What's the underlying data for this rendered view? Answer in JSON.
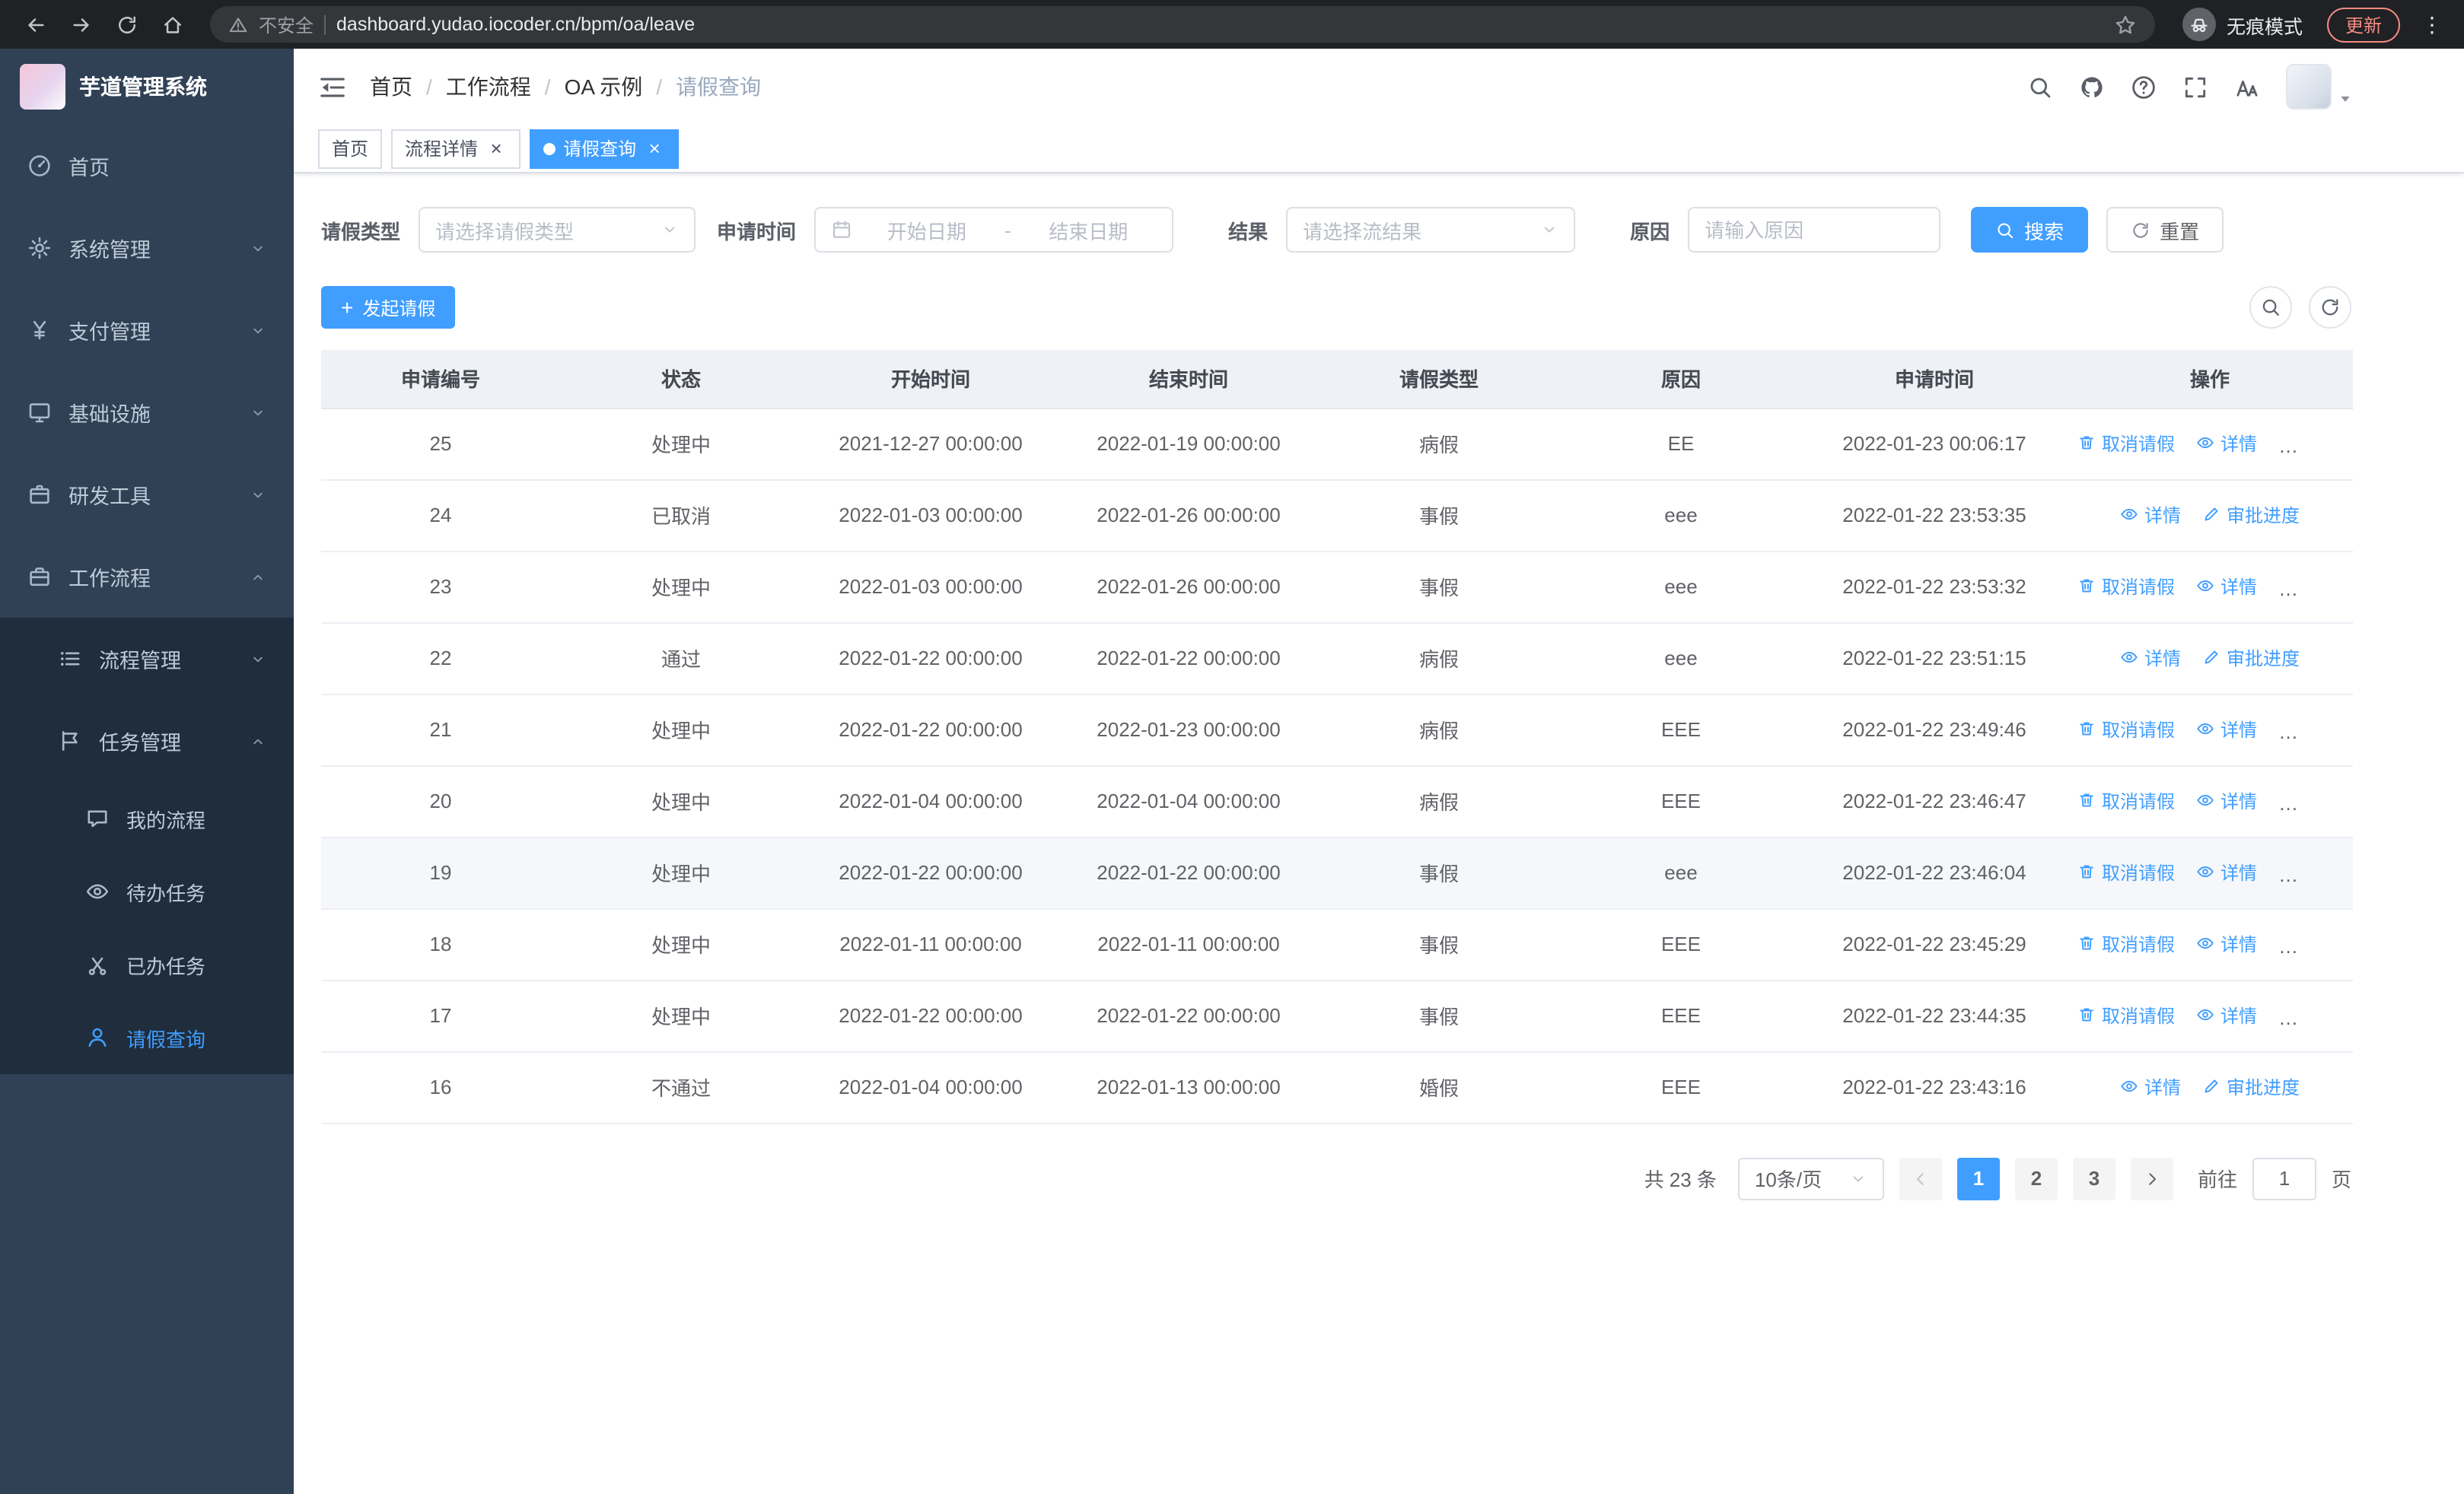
{
  "theme": {
    "accent": "#409eff",
    "sidebar_bg": "#304156",
    "submenu_bg": "#1f2d3d",
    "sidebar_text": "#bfcbd9",
    "table_header_bg": "#eef1f6"
  },
  "browser": {
    "security_warning": "不安全",
    "url": "dashboard.yudao.iocoder.cn/bpm/oa/leave",
    "incognito_label": "无痕模式",
    "update_button": "更新"
  },
  "sidebar": {
    "logo_title": "芋道管理系统",
    "items": [
      {
        "key": "home",
        "label": "首页",
        "icon": "dashboard",
        "expandable": false
      },
      {
        "key": "system-management",
        "label": "系统管理",
        "icon": "gear",
        "expandable": true
      },
      {
        "key": "payment-management",
        "label": "支付管理",
        "icon": "yen",
        "expandable": true
      },
      {
        "key": "infrastructure",
        "label": "基础设施",
        "icon": "infra",
        "expandable": true
      },
      {
        "key": "dev-tools",
        "label": "研发工具",
        "icon": "devtools",
        "expandable": true
      },
      {
        "key": "workflow",
        "label": "工作流程",
        "icon": "workflow",
        "expandable": true,
        "expanded": true
      }
    ],
    "submenu": [
      {
        "key": "process-management",
        "label": "流程管理",
        "icon": "list",
        "expandable": true,
        "expanded": false
      },
      {
        "key": "task-management",
        "label": "任务管理",
        "icon": "flag",
        "expandable": true,
        "expanded": true,
        "children": [
          {
            "key": "my-process",
            "label": "我的流程",
            "icon": "chat",
            "active": false
          },
          {
            "key": "todo-task",
            "label": "待办任务",
            "icon": "eye",
            "active": false
          },
          {
            "key": "done-task",
            "label": "已办任务",
            "icon": "scissors",
            "active": false
          },
          {
            "key": "leave-query",
            "label": "请假查询",
            "icon": "user",
            "active": true
          }
        ]
      }
    ]
  },
  "header": {
    "breadcrumb": [
      "首页",
      "工作流程",
      "OA 示例",
      "请假查询"
    ]
  },
  "tabs": [
    {
      "key": "home",
      "label": "首页",
      "closable": false,
      "active": false
    },
    {
      "key": "process-detail",
      "label": "流程详情",
      "closable": true,
      "active": false
    },
    {
      "key": "leave-query",
      "label": "请假查询",
      "closable": true,
      "active": true
    }
  ],
  "filters": {
    "leave_type_label": "请假类型",
    "leave_type_placeholder": "请选择请假类型",
    "apply_time_label": "申请时间",
    "start_date_placeholder": "开始日期",
    "date_separator": "-",
    "end_date_placeholder": "结束日期",
    "result_label": "结果",
    "result_placeholder": "请选择流结果",
    "reason_label": "原因",
    "reason_placeholder": "请输入原因",
    "search_button": "搜索",
    "reset_button": "重置"
  },
  "toolbar": {
    "create_button": "发起请假",
    "plus": "+"
  },
  "table": {
    "columns": [
      "申请编号",
      "状态",
      "开始时间",
      "结束时间",
      "请假类型",
      "原因",
      "申请时间",
      "操作"
    ],
    "actions": {
      "cancel": "取消请假",
      "detail": "详情",
      "progress": "审批进度"
    },
    "rows": [
      {
        "id": "25",
        "status": "处理中",
        "start": "2021-12-27 00:00:00",
        "end": "2022-01-19 00:00:00",
        "type": "病假",
        "reason": "EE",
        "apply_time": "2022-01-23 00:06:17",
        "can_cancel": true,
        "hover": false
      },
      {
        "id": "24",
        "status": "已取消",
        "start": "2022-01-03 00:00:00",
        "end": "2022-01-26 00:00:00",
        "type": "事假",
        "reason": "eee",
        "apply_time": "2022-01-22 23:53:35",
        "can_cancel": false,
        "hover": false
      },
      {
        "id": "23",
        "status": "处理中",
        "start": "2022-01-03 00:00:00",
        "end": "2022-01-26 00:00:00",
        "type": "事假",
        "reason": "eee",
        "apply_time": "2022-01-22 23:53:32",
        "can_cancel": true,
        "hover": false
      },
      {
        "id": "22",
        "status": "通过",
        "start": "2022-01-22 00:00:00",
        "end": "2022-01-22 00:00:00",
        "type": "病假",
        "reason": "eee",
        "apply_time": "2022-01-22 23:51:15",
        "can_cancel": false,
        "hover": false
      },
      {
        "id": "21",
        "status": "处理中",
        "start": "2022-01-22 00:00:00",
        "end": "2022-01-23 00:00:00",
        "type": "病假",
        "reason": "EEE",
        "apply_time": "2022-01-22 23:49:46",
        "can_cancel": true,
        "hover": false
      },
      {
        "id": "20",
        "status": "处理中",
        "start": "2022-01-04 00:00:00",
        "end": "2022-01-04 00:00:00",
        "type": "病假",
        "reason": "EEE",
        "apply_time": "2022-01-22 23:46:47",
        "can_cancel": true,
        "hover": false
      },
      {
        "id": "19",
        "status": "处理中",
        "start": "2022-01-22 00:00:00",
        "end": "2022-01-22 00:00:00",
        "type": "事假",
        "reason": "eee",
        "apply_time": "2022-01-22 23:46:04",
        "can_cancel": true,
        "hover": true
      },
      {
        "id": "18",
        "status": "处理中",
        "start": "2022-01-11 00:00:00",
        "end": "2022-01-11 00:00:00",
        "type": "事假",
        "reason": "EEE",
        "apply_time": "2022-01-22 23:45:29",
        "can_cancel": true,
        "hover": false
      },
      {
        "id": "17",
        "status": "处理中",
        "start": "2022-01-22 00:00:00",
        "end": "2022-01-22 00:00:00",
        "type": "事假",
        "reason": "EEE",
        "apply_time": "2022-01-22 23:44:35",
        "can_cancel": true,
        "hover": false
      },
      {
        "id": "16",
        "status": "不通过",
        "start": "2022-01-04 00:00:00",
        "end": "2022-01-13 00:00:00",
        "type": "婚假",
        "reason": "EEE",
        "apply_time": "2022-01-22 23:43:16",
        "can_cancel": false,
        "hover": false
      }
    ]
  },
  "pagination": {
    "total": "共 23 条",
    "page_size": "10条/页",
    "pages": [
      "1",
      "2",
      "3"
    ],
    "active_page": "1",
    "goto_label": "前往",
    "goto_value": "1",
    "page_label": "页"
  }
}
